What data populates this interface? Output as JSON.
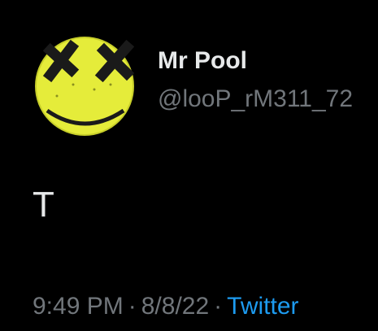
{
  "tweet": {
    "author": {
      "display_name": "Mr Pool",
      "handle": "@looP_rM311_72",
      "avatar_icon": "dead-smiley-face-icon"
    },
    "text": "T",
    "meta": {
      "time": "9:49 PM",
      "separator": "·",
      "date": "8/8/22",
      "source": "Twitter"
    }
  },
  "colors": {
    "background": "#000000",
    "primary_text": "#e7e9ea",
    "secondary_text": "#71767b",
    "link": "#1d9bf0",
    "avatar_yellow": "#e9f03a"
  }
}
